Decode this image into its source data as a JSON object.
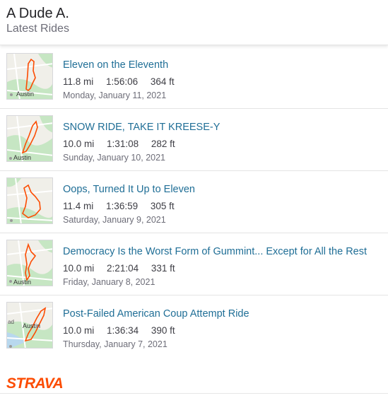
{
  "header": {
    "athlete_name": "A Dude A.",
    "subtitle": "Latest Rides"
  },
  "rides": [
    {
      "title": "Eleven on the Eleventh",
      "distance": "11.8 mi",
      "time": "1:56:06",
      "elevation": "364 ft",
      "date": "Monday, January 11, 2021",
      "map_label": "Austin"
    },
    {
      "title": "SNOW RIDE, TAKE IT KREESE-Y",
      "distance": "10.0 mi",
      "time": "1:31:08",
      "elevation": "282 ft",
      "date": "Sunday, January 10, 2021",
      "map_label": "Austin"
    },
    {
      "title": "Oops, Turned It Up to Eleven",
      "distance": "11.4 mi",
      "time": "1:36:59",
      "elevation": "305 ft",
      "date": "Saturday, January 9, 2021",
      "map_label": ""
    },
    {
      "title": "Democracy Is the Worst Form of Gummint... Except for All the Rest",
      "distance": "10.0 mi",
      "time": "2:21:04",
      "elevation": "331 ft",
      "date": "Friday, January 8, 2021",
      "map_label": "Austin"
    },
    {
      "title": "Post-Failed American Coup Attempt Ride",
      "distance": "10.0 mi",
      "time": "1:36:34",
      "elevation": "390 ft",
      "date": "Thursday, January 7, 2021",
      "map_label": "Austin"
    }
  ],
  "footer": {
    "logo_text": "STRAVA",
    "logo_color": "#fc4c02"
  },
  "colors": {
    "route": "#fc4c02",
    "link": "#1f6e96",
    "map_park": "#c6e6c3",
    "map_water": "#b8d8ee"
  }
}
